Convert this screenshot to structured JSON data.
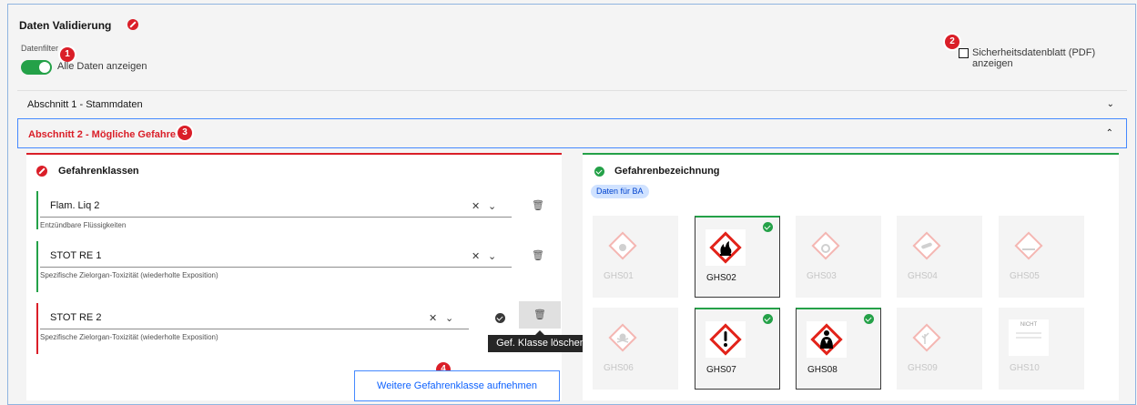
{
  "header": {
    "title": "Daten Validierung",
    "filter_label": "Datenfilter",
    "toggle_label": "Alle Daten anzeigen",
    "pdf_label": "Sicherheitsdatenblatt (PDF) anzeigen"
  },
  "badges": [
    "1",
    "2",
    "3",
    "4"
  ],
  "accordion": {
    "section1": "Abschnitt 1 - Stammdaten",
    "section2": "Abschnitt 2 - Mögliche Gefahren"
  },
  "hazard_classes": {
    "title": "Gefahrenklassen",
    "items": [
      {
        "value": "Flam. Liq 2",
        "desc": "Entzündbare Flüssigkeiten",
        "status": "ok"
      },
      {
        "value": "STOT RE 1",
        "desc": "Spezifische Zielorgan-Toxizität (wiederholte Exposition)",
        "status": "ok"
      },
      {
        "value": "STOT RE 2",
        "desc": "Spezifische Zielorgan-Toxizität (wiederholte Exposition)",
        "status": "error"
      }
    ],
    "tooltip": "Gef. Klasse löschen",
    "add_button": "Weitere Gefahrenklasse aufnehmen"
  },
  "hazard_labels": {
    "title": "Gefahrenbezeichnung",
    "tag": "Daten für BA",
    "pictograms": [
      {
        "code": "GHS01",
        "selected": false,
        "icon": "exploding-bomb-icon"
      },
      {
        "code": "GHS02",
        "selected": true,
        "icon": "flame-icon"
      },
      {
        "code": "GHS03",
        "selected": false,
        "icon": "flame-over-circle-icon"
      },
      {
        "code": "GHS04",
        "selected": false,
        "icon": "gas-cylinder-icon"
      },
      {
        "code": "GHS05",
        "selected": false,
        "icon": "corrosion-icon"
      },
      {
        "code": "GHS06",
        "selected": false,
        "icon": "skull-icon"
      },
      {
        "code": "GHS07",
        "selected": true,
        "icon": "exclamation-icon"
      },
      {
        "code": "GHS08",
        "selected": true,
        "icon": "health-hazard-icon"
      },
      {
        "code": "GHS09",
        "selected": false,
        "icon": "environment-icon"
      },
      {
        "code": "GHS10",
        "selected": false,
        "icon": "not-applicable-icon",
        "sign_text": "NICHT"
      }
    ]
  },
  "colors": {
    "error": "#da1e28",
    "success": "#24a148",
    "link": "#0f62fe",
    "ghs_red": "#e2231a"
  }
}
